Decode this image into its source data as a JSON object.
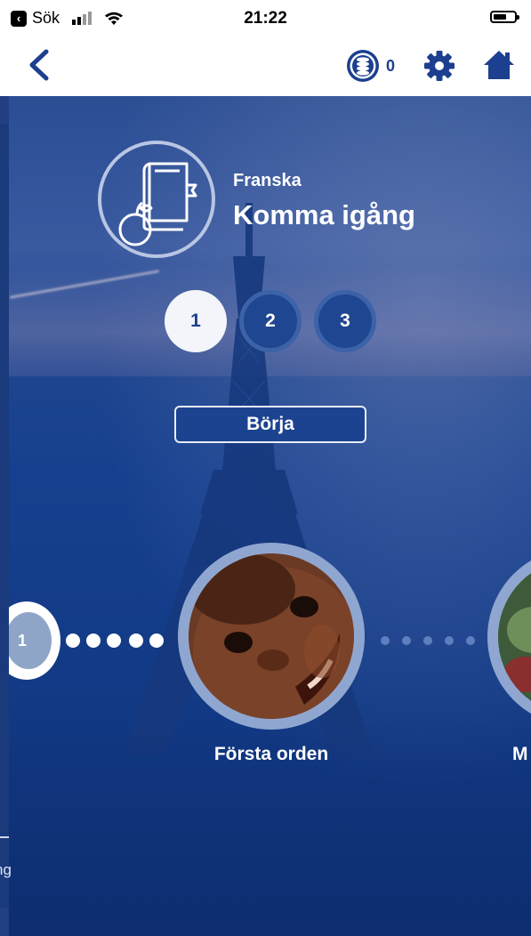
{
  "status_bar": {
    "back_app": "Sök",
    "time": "21:22"
  },
  "nav": {
    "coins": "0"
  },
  "course": {
    "subject": "Franska",
    "title": "Komma igång"
  },
  "levels": [
    "1",
    "2",
    "3"
  ],
  "start_button": "Börja",
  "path": {
    "current_node": "1",
    "lessons": [
      {
        "label": "Första orden"
      },
      {
        "label": "M"
      }
    ]
  },
  "left_edge_text": "ng",
  "colors": {
    "primary": "#1c3f8f",
    "background": "#16408f",
    "white": "#ffffff"
  }
}
